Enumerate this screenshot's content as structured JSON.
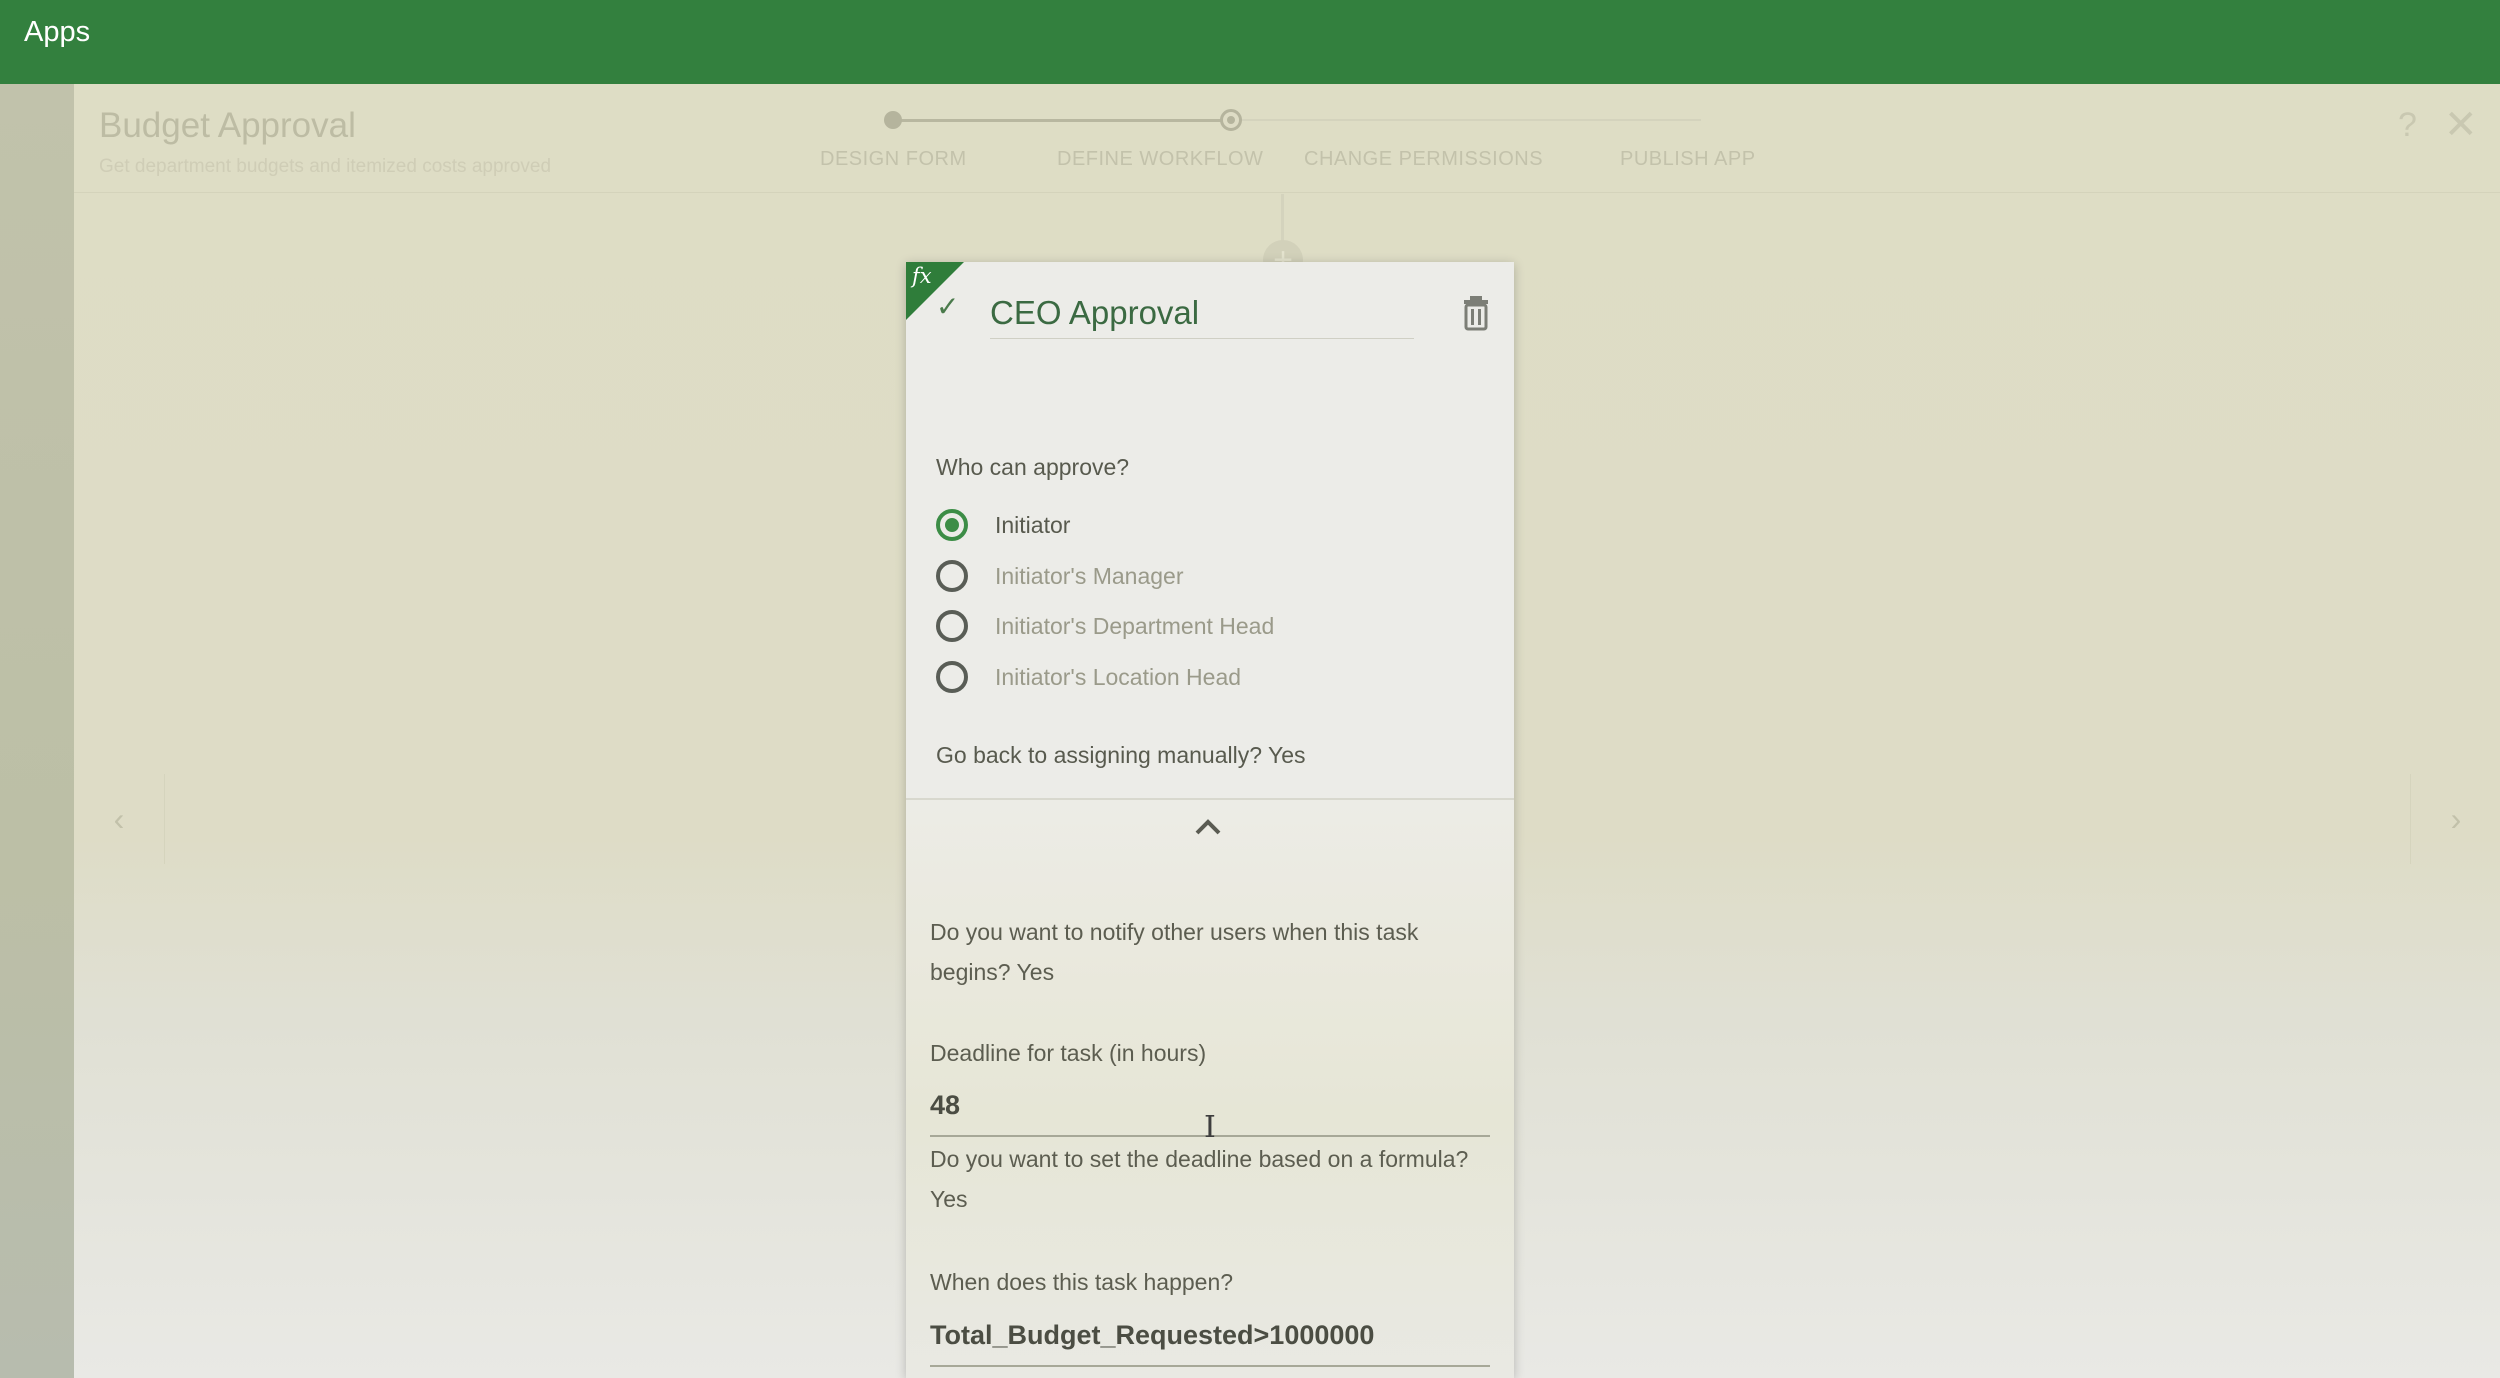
{
  "topbar": {
    "title": "Apps"
  },
  "app": {
    "name": "Budget Approval",
    "description": "Get department budgets and itemized costs approved"
  },
  "stepper": {
    "steps": [
      {
        "label": "DESIGN FORM",
        "state": "done"
      },
      {
        "label": "DEFINE WORKFLOW",
        "state": "current"
      },
      {
        "label": "CHANGE PERMISSIONS",
        "state": "todo"
      },
      {
        "label": "PUBLISH APP",
        "state": "todo"
      }
    ]
  },
  "header_icons": {
    "help": "?",
    "close": "✕"
  },
  "workflow": {
    "add_node_icon": "+",
    "prev_arrow": "‹",
    "next_arrow": "›"
  },
  "card": {
    "fx_badge": "fx",
    "check_icon": "✓",
    "task_name": "CEO Approval",
    "who_can_approve_label": "Who can approve?",
    "approvers": [
      {
        "label": "Initiator",
        "selected": true
      },
      {
        "label": "Initiator's Manager",
        "selected": false
      },
      {
        "label": "Initiator's Department Head",
        "selected": false
      },
      {
        "label": "Initiator's Location Head",
        "selected": false
      }
    ],
    "manual_assign_text": "Go back to assigning manually? Yes",
    "notify_text": "Do you want to notify other users when this task begins? Yes",
    "deadline_label": "Deadline for task (in hours)",
    "deadline_value": "48",
    "deadline_formula_text": "Do you want to set the deadline based on a formula? Yes",
    "when_label": "When does this task happen?",
    "when_value": "Total_Budget_Requested>1000000"
  },
  "colors": {
    "brand_green": "#33803e",
    "radio_selected": "#3c8d46",
    "fx_corner": "#2f7d3a"
  }
}
